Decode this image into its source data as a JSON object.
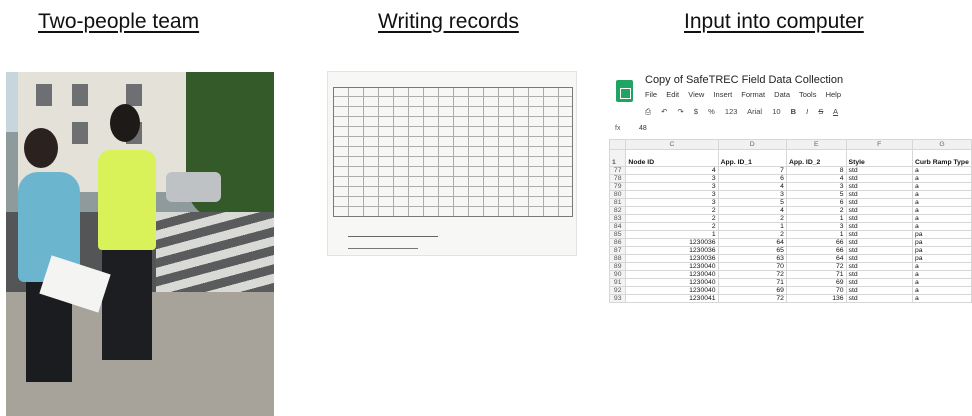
{
  "headings": {
    "team": "Two-people team",
    "records": "Writing records",
    "computer": "Input into computer"
  },
  "sheet": {
    "title": "Copy of SafeTREC Field Data Collection",
    "menu": [
      "File",
      "Edit",
      "View",
      "Insert",
      "Format",
      "Data",
      "Tools",
      "Help"
    ],
    "toolbar": [
      "$",
      "%",
      "123",
      "Arial",
      "10",
      "B",
      "I",
      "S",
      "A"
    ],
    "fx_label": "fx",
    "fx_value": "48",
    "col_letters": [
      "",
      "C",
      "D",
      "E",
      "F",
      "G"
    ],
    "headers": [
      "Node ID",
      "App. ID_1",
      "App. ID_2",
      "Style",
      "Curb Ramp Type"
    ],
    "rows": [
      [
        "77",
        "4",
        "7",
        "8",
        "std",
        "a"
      ],
      [
        "78",
        "3",
        "6",
        "4",
        "std",
        "a"
      ],
      [
        "79",
        "3",
        "4",
        "3",
        "std",
        "a"
      ],
      [
        "80",
        "3",
        "3",
        "5",
        "std",
        "a"
      ],
      [
        "81",
        "3",
        "5",
        "6",
        "std",
        "a"
      ],
      [
        "82",
        "2",
        "4",
        "2",
        "std",
        "a"
      ],
      [
        "83",
        "2",
        "2",
        "1",
        "std",
        "a"
      ],
      [
        "84",
        "2",
        "1",
        "3",
        "std",
        "a"
      ],
      [
        "85",
        "1",
        "2",
        "1",
        "std",
        "pa"
      ],
      [
        "86",
        "1230036",
        "64",
        "66",
        "std",
        "pa"
      ],
      [
        "87",
        "1230036",
        "65",
        "66",
        "std",
        "pa"
      ],
      [
        "88",
        "1230036",
        "63",
        "64",
        "std",
        "pa"
      ],
      [
        "89",
        "1230040",
        "70",
        "72",
        "std",
        "a"
      ],
      [
        "90",
        "1230040",
        "72",
        "71",
        "std",
        "a"
      ],
      [
        "91",
        "1230040",
        "71",
        "69",
        "std",
        "a"
      ],
      [
        "92",
        "1230040",
        "69",
        "70",
        "std",
        "a"
      ],
      [
        "93",
        "1230041",
        "72",
        "136",
        "std",
        "a"
      ]
    ]
  }
}
